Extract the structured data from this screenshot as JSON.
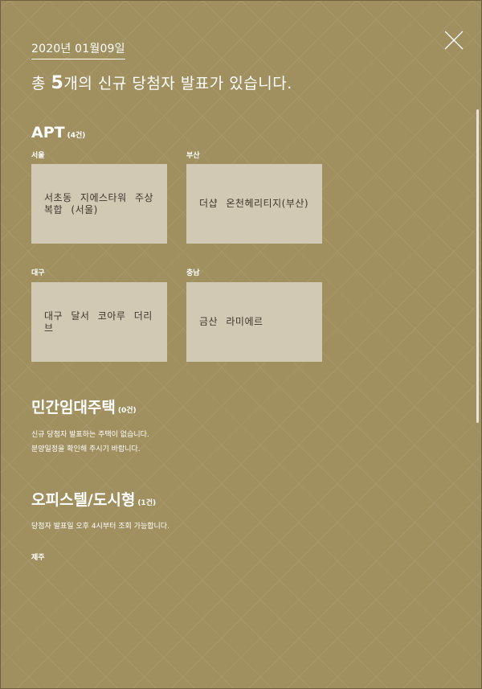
{
  "date": "2020년 01월09일",
  "headline": {
    "prefix": "총 ",
    "count": "5",
    "suffix": "개의 신규 당첨자 발표가 있습니다."
  },
  "sections": {
    "apt": {
      "title": "APT",
      "count": "(4건)",
      "items": [
        {
          "region": "서울",
          "name": "서초동 지에스타워 주상복합 (서울)"
        },
        {
          "region": "부산",
          "name": "더샵 온천헤리티지(부산)"
        },
        {
          "region": "대구",
          "name": "대구 달서 코아루 더리브"
        },
        {
          "region": "충남",
          "name": "금산 라미에르"
        }
      ]
    },
    "rental": {
      "title": "민간임대주택",
      "count": "(0건)",
      "notes": [
        "신규 당첨자 발표하는 주택이 없습니다.",
        "분양일정을 확인해 주시기 바랍니다."
      ]
    },
    "officetel": {
      "title": "오피스텔/도시형",
      "count": "(1건)",
      "note": "당첨자 발표일 오후 4시부터 조회 가능합니다.",
      "region": "제주"
    }
  },
  "icons": {
    "close": "close-icon"
  }
}
